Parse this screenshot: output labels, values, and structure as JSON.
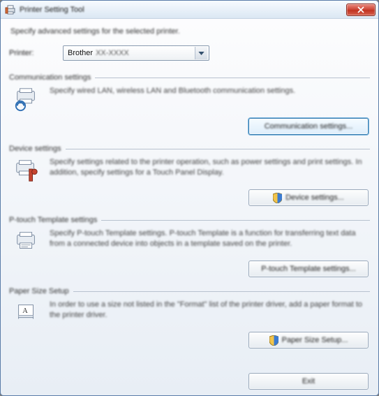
{
  "titlebar": {
    "title": "Printer Setting Tool"
  },
  "intro": "Specify advanced settings for the selected printer.",
  "printer": {
    "label": "Printer:",
    "value_visible": "Brother",
    "value_obscured": "XX-XXXX"
  },
  "sections": {
    "comm": {
      "title": "Communication settings",
      "desc": "Specify wired LAN, wireless LAN and Bluetooth communication settings.",
      "button": "Communication settings..."
    },
    "device": {
      "title": "Device settings",
      "desc": "Specify settings related to the printer operation, such as power settings and print settings.\nIn addition, specify settings for a Touch Panel Display.",
      "button": "Device settings..."
    },
    "template": {
      "title": "P-touch Template settings",
      "desc": "Specify P-touch Template settings.\nP-touch Template is a function for transferring text data from a connected device into objects in a template saved on the printer.",
      "button": "P-touch Template settings..."
    },
    "paper": {
      "title": "Paper Size Setup",
      "desc": "In order to use a size not listed in the \"Format\" list of the printer driver, add a paper format to the printer driver.",
      "button": "Paper Size Setup..."
    }
  },
  "exit_button": "Exit"
}
